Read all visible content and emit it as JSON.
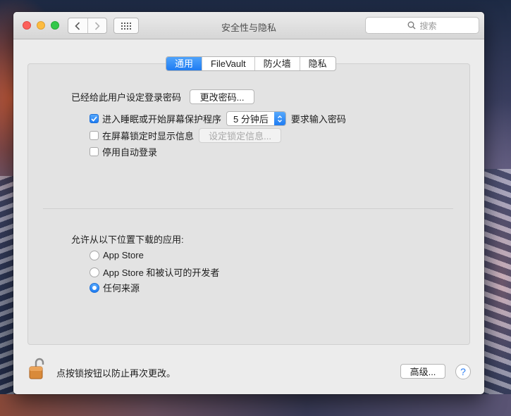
{
  "window": {
    "title": "安全性与隐私",
    "search_placeholder": "搜索"
  },
  "tabs": [
    {
      "label": "通用",
      "active": true
    },
    {
      "label": "FileVault",
      "active": false
    },
    {
      "label": "防火墙",
      "active": false
    },
    {
      "label": "隐私",
      "active": false
    }
  ],
  "general": {
    "password_label": "已经给此用户设定登录密码",
    "change_password_button": "更改密码...",
    "require_password": {
      "checked": true,
      "prefix": "进入睡眠或开始屏幕保护程序",
      "delay_value": "5 分钟后",
      "suffix": "要求输入密码"
    },
    "lock_message": {
      "checked": false,
      "label": "在屏幕锁定时显示信息",
      "button": "设定锁定信息..."
    },
    "disable_auto_login": {
      "checked": false,
      "label": "停用自动登录"
    }
  },
  "downloads": {
    "heading": "允许从以下位置下载的应用:",
    "options": [
      {
        "label": "App Store",
        "selected": false
      },
      {
        "label": "App Store 和被认可的开发者",
        "selected": false
      },
      {
        "label": "任何来源",
        "selected": true
      }
    ]
  },
  "footer": {
    "lock_text": "点按锁按钮以防止再次更改。",
    "advanced_button": "高级...",
    "help_label": "?"
  },
  "colors": {
    "accent": "#1f7cf2",
    "close": "#fc605b",
    "minimize": "#fdbc40",
    "maximize": "#34c84a",
    "lock": "#d98a3a"
  },
  "icons": [
    "back-chevron-icon",
    "forward-chevron-icon",
    "grid-icon",
    "search-icon",
    "checkmark-icon",
    "updown-arrows-icon",
    "padlock-icon"
  ]
}
